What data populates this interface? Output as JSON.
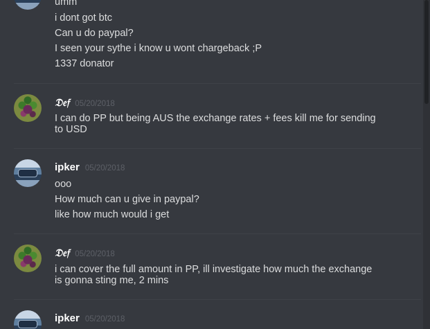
{
  "messages": [
    {
      "author": "",
      "timestamp": "",
      "lines": [
        "umm",
        "i dont got btc",
        "Can u do paypal?",
        "I seen your sythe i know u wont chargeback ;P",
        "1337 donator"
      ]
    },
    {
      "author": "𝔇𝔢𝔣",
      "timestamp": "05/20/2018",
      "lines": [
        "I can do PP but being AUS the exchange rates + fees kill me for sending to USD"
      ]
    },
    {
      "author": "ipker",
      "timestamp": "05/20/2018",
      "lines": [
        "ooo",
        "How much can u give in paypal?",
        "like how much would i get"
      ]
    },
    {
      "author": "𝔇𝔢𝔣",
      "timestamp": "05/20/2018",
      "lines": [
        "i can cover the full amount in PP, ill investigate how much the exchange is gonna sting me, 2 mins"
      ]
    },
    {
      "author": "ipker",
      "timestamp": "05/20/2018",
      "lines": []
    }
  ],
  "icons": {
    "avatar_def": "avatar-def-icon",
    "avatar_ipker": "avatar-ipker-icon"
  },
  "colors": {
    "background": "#36393f",
    "text": "#dcddde",
    "author": "#ffffff",
    "timestamp": "#5d6067"
  }
}
